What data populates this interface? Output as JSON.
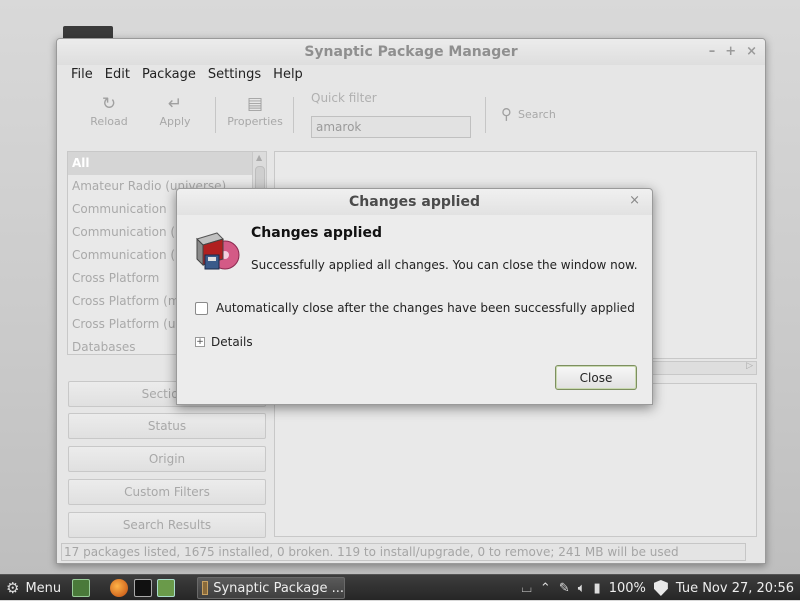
{
  "main_window": {
    "title": "Synaptic Package Manager",
    "controls": [
      "–",
      "+",
      "×"
    ],
    "menu": [
      "File",
      "Edit",
      "Package",
      "Settings",
      "Help"
    ],
    "toolbar": {
      "reload": "Reload",
      "apply": "Apply",
      "properties": "Properties",
      "quick_filter_label": "Quick filter",
      "quick_filter_value": "amarok",
      "search": "Search"
    },
    "categories": [
      "All",
      "Amateur Radio (universe)",
      "Communication",
      "Communication (",
      "Communication (",
      "Cross Platform",
      "Cross Platform (m",
      "Cross Platform (u",
      "Databases"
    ],
    "filter_buttons": [
      "Sections",
      "Status",
      "Origin",
      "Custom Filters",
      "Search Results"
    ],
    "status_bar": "17 packages listed, 1675 installed, 0 broken. 119 to install/upgrade, 0 to remove; 241 MB will be used"
  },
  "dialog": {
    "title": "Changes applied",
    "close_glyph": "×",
    "heading": "Changes applied",
    "message": "Successfully applied all changes. You can close the window now.",
    "auto_close_label": "Automatically close after the changes have been successfully applied",
    "auto_close_checked": false,
    "details_label": "Details",
    "close_button": "Close"
  },
  "taskbar": {
    "menu_label": "Menu",
    "task_label": "Synaptic Package ...",
    "battery": "100%",
    "clock": "Tue Nov 27, 20:56"
  },
  "colors": {
    "accent_button_border": "#7d8f60",
    "taskbar_bg": "#2e2e2e"
  },
  "icons": [
    "gear-icon",
    "reload-icon",
    "apply-icon",
    "properties-icon",
    "search-icon",
    "package-icon",
    "shield-icon"
  ]
}
